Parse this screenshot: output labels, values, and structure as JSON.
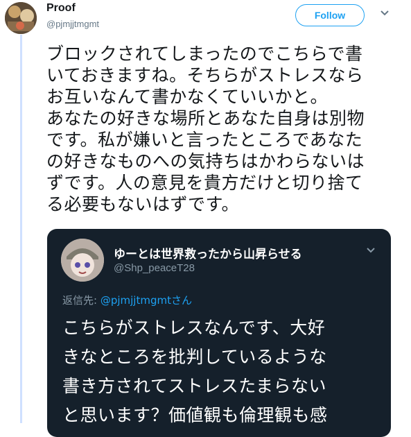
{
  "tweet": {
    "display_name": "Proof",
    "handle": "@pjmjjtmgmt",
    "follow_label": "Follow",
    "text": "ブロックされてしまったのでこちらで書\nいておきますね。そちらがストレスなら\nお互いなんて書かなくていいかと。\nあなたの好きな場所とあなた自身は別物\nです。私が嫌いと言ったところであなた\nの好きなものへの気持ちはかわらないは\nずです。人の意見を貴方だけと切り捨て\nる必要もないはずです。"
  },
  "quoted_tweet": {
    "display_name": "ゆーとは世界救ったから山昇らせる",
    "handle": "@Shp_peaceT28",
    "reply_prefix": "返信先: ",
    "reply_mention": "@pjmjjtmgmt",
    "reply_suffix": "さん",
    "text": "こちらがストレスなんです、大好\nきなところを批判しているような\n書き方されてストレスたまらない\nと思います？価値観も倫理観も感"
  },
  "colors": {
    "accent": "#1da1f2",
    "quote_background": "#15202b",
    "thread_line": "#cfe0ff"
  }
}
